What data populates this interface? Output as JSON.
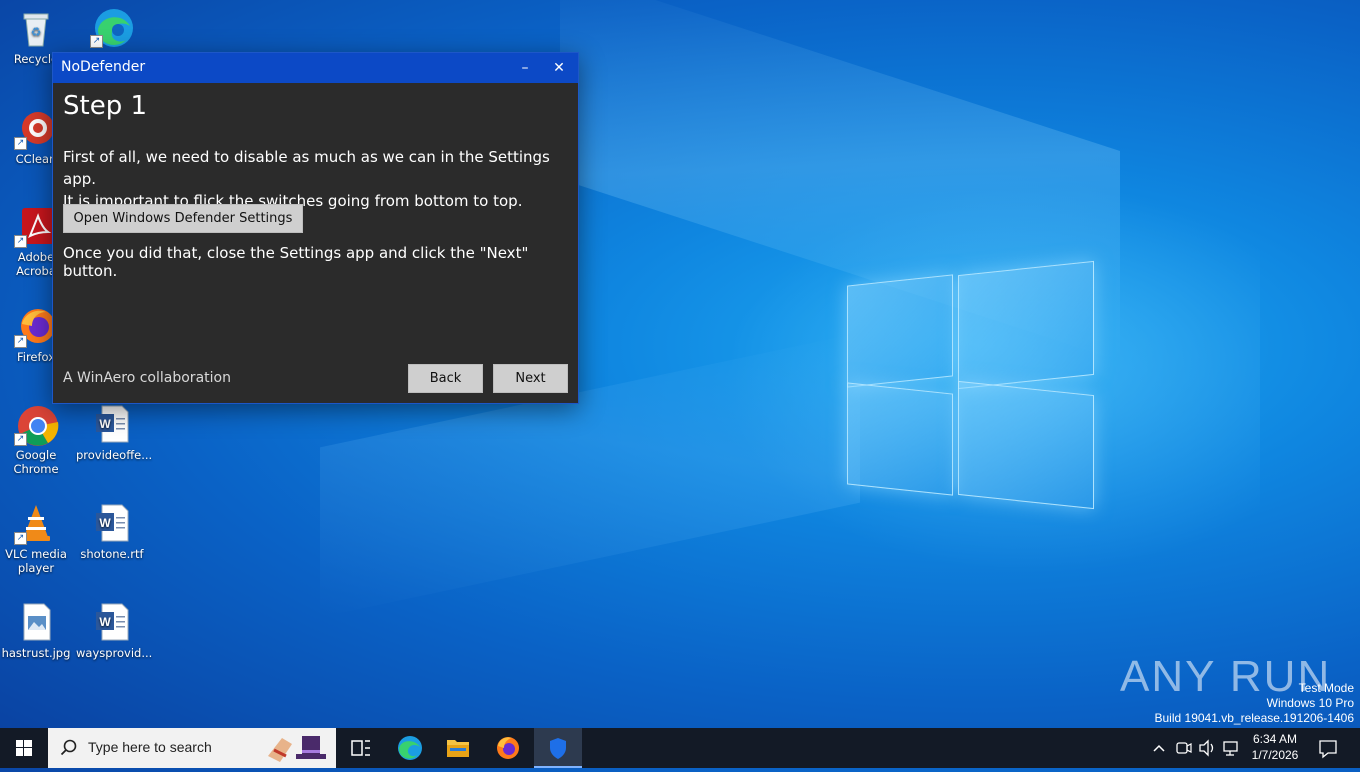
{
  "window": {
    "title": "NoDefender",
    "minimize_glyph": "–",
    "close_glyph": "✕",
    "heading": "Step 1",
    "paragraph_line1": "First of all, we need to disable as much as we can in the Settings app.",
    "paragraph_line2": "It is important to flick the switches going from bottom to top.",
    "open_settings_label": "Open Windows Defender Settings",
    "instruction": "Once you did that, close the Settings app and click the \"Next\" button.",
    "footer": "A WinAero collaboration",
    "back_label": "Back",
    "next_label": "Next"
  },
  "desktop_icons": [
    {
      "label": "Recycle",
      "icon": "recycle-bin-icon"
    },
    {
      "label": "",
      "icon": "edge-icon"
    },
    {
      "label": "CClean",
      "icon": "ccleaner-icon"
    },
    {
      "label": "Adobe Acroba",
      "icon": "acrobat-icon"
    },
    {
      "label": "Firefox",
      "icon": "firefox-icon"
    },
    {
      "label": "Google Chrome",
      "icon": "chrome-icon"
    },
    {
      "label": "provideoffe...",
      "icon": "word-doc-icon"
    },
    {
      "label": "VLC media player",
      "icon": "vlc-icon"
    },
    {
      "label": "shotone.rtf",
      "icon": "word-doc-icon"
    },
    {
      "label": "hastrust.jpg",
      "icon": "image-file-icon"
    },
    {
      "label": "waysprovid...",
      "icon": "word-doc-icon"
    }
  ],
  "watermark": {
    "brand": "ANY RUN",
    "line1": "Test Mode",
    "line2": "Windows 10 Pro",
    "line3": "Build 19041.vb_release.191206-1406"
  },
  "taskbar": {
    "search_placeholder": "Type here to search",
    "time": "6:34 AM",
    "date": "1/7/2026"
  },
  "colors": {
    "title_bar": "#0c49c6",
    "window_bg": "#2b2b2b",
    "button_bg": "#cfcfcf"
  }
}
